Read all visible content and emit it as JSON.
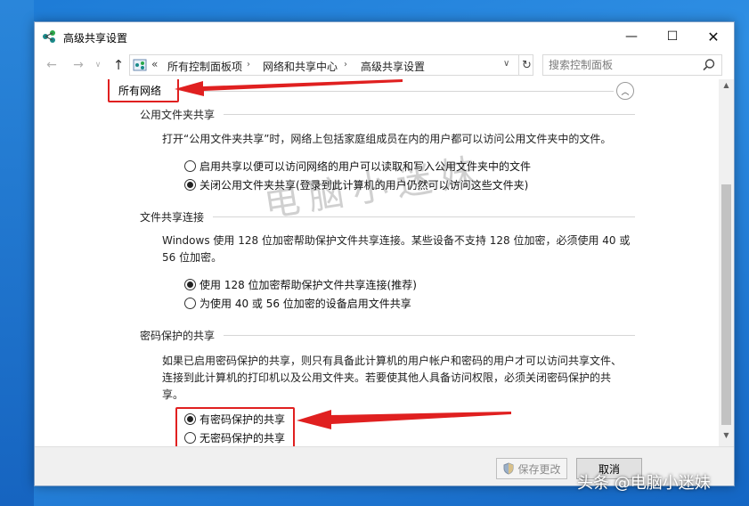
{
  "window": {
    "title": "高级共享设置",
    "minimize_glyph": "—",
    "maximize_glyph": "☐",
    "close_glyph": "✕"
  },
  "addressbar": {
    "back_glyph": "←",
    "forward_glyph": "→",
    "recent_glyph": "∨",
    "up_glyph": "↑",
    "chevrons": "«",
    "breadcrumbs": [
      "所有控制面板项",
      "网络和共享中心",
      "高级共享设置"
    ],
    "separator": "›",
    "dropdown_glyph": "∨",
    "refresh_glyph": "↻",
    "search_placeholder": "搜索控制面板"
  },
  "content": {
    "section_title": "所有网络",
    "collapse_glyph": "︿",
    "public_folder": {
      "title": "公用文件夹共享",
      "description": "打开“公用文件夹共享”时，网络上包括家庭组成员在内的用户都可以访问公用文件夹中的文件。",
      "options": [
        {
          "label": "启用共享以便可以访问网络的用户可以读取和写入公用文件夹中的文件",
          "checked": false
        },
        {
          "label": "关闭公用文件夹共享(登录到此计算机的用户仍然可以访问这些文件夹)",
          "checked": true
        }
      ]
    },
    "file_sharing_connections": {
      "title": "文件共享连接",
      "description": "Windows 使用 128 位加密帮助保护文件共享连接。某些设备不支持 128 位加密，必须使用 40 或 56 位加密。",
      "options": [
        {
          "label": "使用 128 位加密帮助保护文件共享连接(推荐)",
          "checked": true
        },
        {
          "label": "为使用 40 或 56 位加密的设备启用文件共享",
          "checked": false
        }
      ]
    },
    "password_protected": {
      "title": "密码保护的共享",
      "description": "如果已启用密码保护的共享，则只有具备此计算机的用户帐户和密码的用户才可以访问共享文件、连接到此计算机的打印机以及公用文件夹。若要使其他人具备访问权限，必须关闭密码保护的共享。",
      "options": [
        {
          "label": "有密码保护的共享",
          "checked": true
        },
        {
          "label": "无密码保护的共享",
          "checked": false
        }
      ]
    }
  },
  "scrollbar": {
    "up_glyph": "▲",
    "down_glyph": "▼"
  },
  "footer": {
    "save_label": "保存更改",
    "cancel_label": "取消"
  },
  "overlay": {
    "watermark": "电脑小迷妹",
    "credit": "头条 @电脑小迷妹"
  },
  "colors": {
    "annotation_red": "#e02020",
    "desktop_blue": "#1d7bd6"
  }
}
